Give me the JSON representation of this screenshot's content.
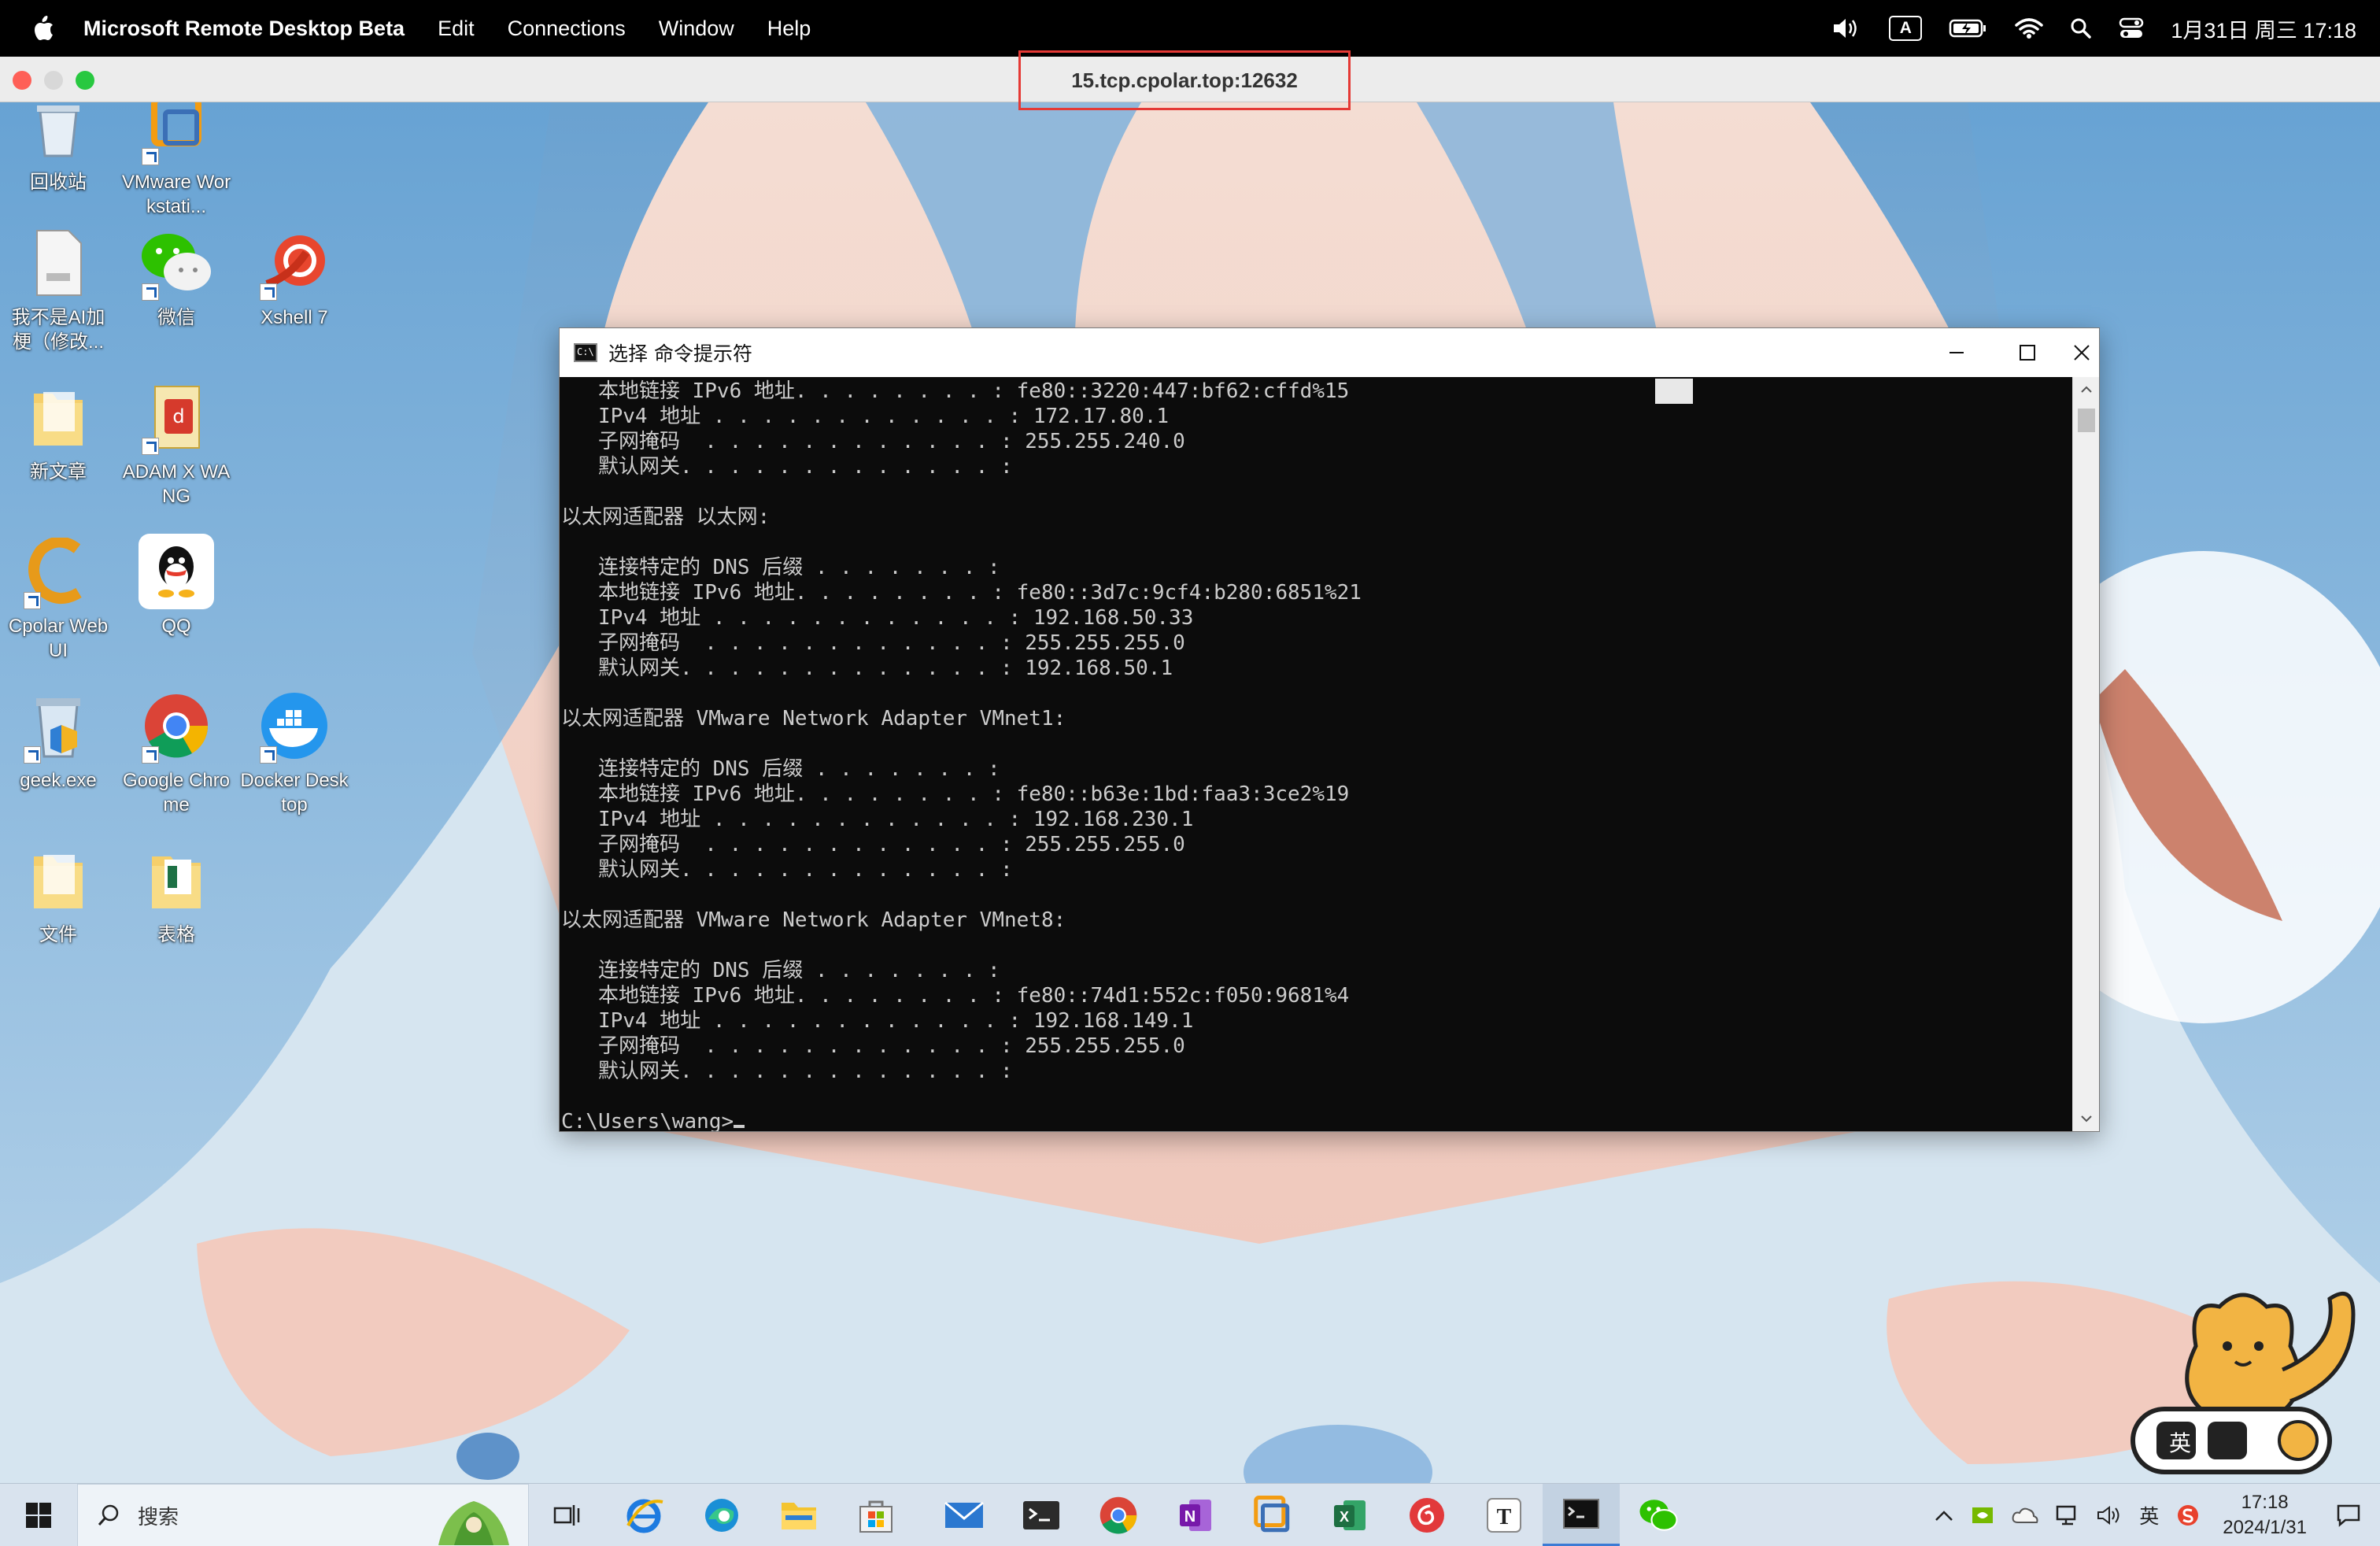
{
  "menubar": {
    "app_name": "Microsoft Remote Desktop Beta",
    "menus": [
      "Edit",
      "Connections",
      "Window",
      "Help"
    ],
    "ime_indicator": "A",
    "clock": "1月31日 周三  17:18"
  },
  "rdp_window": {
    "host": "15.tcp.cpolar.top:12632"
  },
  "desktop_icons": [
    {
      "label": "回收站"
    },
    {
      "label": "VMware Workstati..."
    },
    {
      "label": "我不是AI加梗（修改..."
    },
    {
      "label": "微信"
    },
    {
      "label": "Xshell 7"
    },
    {
      "label": "新文章"
    },
    {
      "label": "ADAM X WANG"
    },
    {
      "label": "Cpolar Web UI"
    },
    {
      "label": "QQ"
    },
    {
      "label": "geek.exe"
    },
    {
      "label": "Google Chrome"
    },
    {
      "label": "Docker Desktop"
    },
    {
      "label": "文件"
    },
    {
      "label": "表格"
    }
  ],
  "cmd_window": {
    "title": "选择 命令提示符",
    "lines": [
      "   本地链接 IPv6 地址. . . . . . . . : fe80::3220:447:bf62:cffd%15",
      "   IPv4 地址 . . . . . . . . . . . . : 172.17.80.1",
      "   子网掩码  . . . . . . . . . . . . : 255.255.240.0",
      "   默认网关. . . . . . . . . . . . . :",
      "",
      "以太网适配器 以太网:",
      "",
      "   连接特定的 DNS 后缀 . . . . . . . :",
      "   本地链接 IPv6 地址. . . . . . . . : fe80::3d7c:9cf4:b280:6851%21",
      "   IPv4 地址 . . . . . . . . . . . . : 192.168.50.33",
      "   子网掩码  . . . . . . . . . . . . : 255.255.255.0",
      "   默认网关. . . . . . . . . . . . . : 192.168.50.1",
      "",
      "以太网适配器 VMware Network Adapter VMnet1:",
      "",
      "   连接特定的 DNS 后缀 . . . . . . . :",
      "   本地链接 IPv6 地址. . . . . . . . : fe80::b63e:1bd:faa3:3ce2%19",
      "   IPv4 地址 . . . . . . . . . . . . : 192.168.230.1",
      "   子网掩码  . . . . . . . . . . . . : 255.255.255.0",
      "   默认网关. . . . . . . . . . . . . :",
      "",
      "以太网适配器 VMware Network Adapter VMnet8:",
      "",
      "   连接特定的 DNS 后缀 . . . . . . . :",
      "   本地链接 IPv6 地址. . . . . . . . : fe80::74d1:552c:f050:9681%4",
      "   IPv4 地址 . . . . . . . . . . . . : 192.168.149.1",
      "   子网掩码  . . . . . . . . . . . . : 255.255.255.0",
      "   默认网关. . . . . . . . . . . . . :",
      ""
    ],
    "prompt": "C:\\Users\\wang>"
  },
  "taskbar": {
    "search_placeholder": "搜索",
    "tray_lang": "英",
    "time": "17:18",
    "date": "2024/1/31",
    "ime_widget_label": "英"
  }
}
